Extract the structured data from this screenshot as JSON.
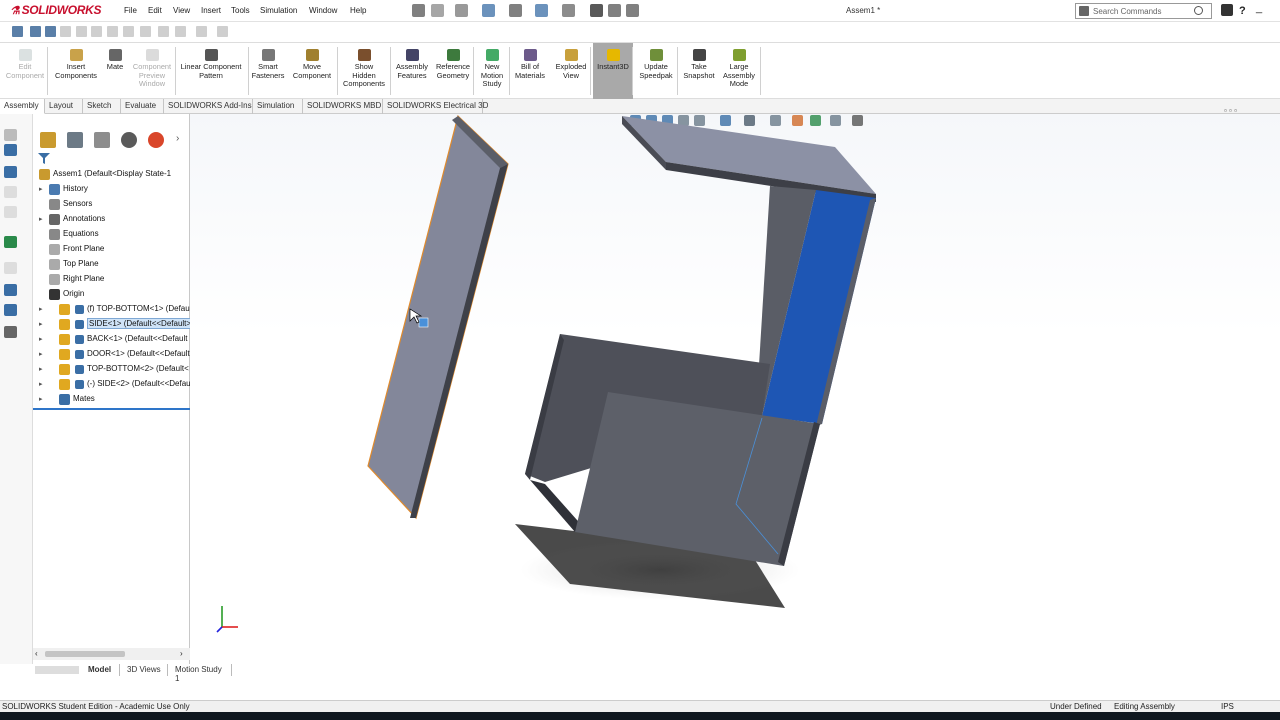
{
  "app": {
    "logo_text": "SOLIDWORKS",
    "doc_title": "Assem1 *"
  },
  "menu": [
    "File",
    "Edit",
    "View",
    "Insert",
    "Tools",
    "Simulation",
    "Window",
    "Help"
  ],
  "search": {
    "placeholder": "Search Commands"
  },
  "commands": [
    {
      "label": "Edit\nComponent",
      "disabled": true
    },
    {
      "label": "Insert\nComponents",
      "disabled": false
    },
    {
      "label": "Mate",
      "disabled": false
    },
    {
      "label": "Component\nPreview\nWindow",
      "disabled": true
    },
    {
      "label": "Linear Component\nPattern",
      "disabled": false
    },
    {
      "label": "Smart\nFasteners",
      "disabled": false
    },
    {
      "label": "Move\nComponent",
      "disabled": false
    },
    {
      "label": "Show\nHidden\nComponents",
      "disabled": false
    },
    {
      "label": "Assembly\nFeatures",
      "disabled": false
    },
    {
      "label": "Reference\nGeometry",
      "disabled": false
    },
    {
      "label": "New\nMotion\nStudy",
      "disabled": false
    },
    {
      "label": "Bill of\nMaterials",
      "disabled": false
    },
    {
      "label": "Exploded\nView",
      "disabled": false
    },
    {
      "label": "Instant3D",
      "disabled": false,
      "active": true
    },
    {
      "label": "Update\nSpeedpak",
      "disabled": false
    },
    {
      "label": "Take\nSnapshot",
      "disabled": false
    },
    {
      "label": "Large\nAssembly\nMode",
      "disabled": false
    }
  ],
  "tabs": [
    "Assembly",
    "Layout",
    "Sketch",
    "Evaluate",
    "SOLIDWORKS Add-Ins",
    "Simulation",
    "SOLIDWORKS MBD",
    "SOLIDWORKS Electrical 3D"
  ],
  "tree": [
    {
      "label": "Assem1  (Default<Display State-1",
      "icon": "assembly",
      "expand": "▾"
    },
    {
      "label": "History",
      "icon": "history",
      "expand": "▸"
    },
    {
      "label": "Sensors",
      "icon": "sensor",
      "expand": ""
    },
    {
      "label": "Annotations",
      "icon": "annotation",
      "expand": "▸"
    },
    {
      "label": "Equations",
      "icon": "equation",
      "expand": ""
    },
    {
      "label": "Front Plane",
      "icon": "plane",
      "expand": ""
    },
    {
      "label": "Top Plane",
      "icon": "plane",
      "expand": ""
    },
    {
      "label": "Right Plane",
      "icon": "plane",
      "expand": ""
    },
    {
      "label": "Origin",
      "icon": "origin",
      "expand": ""
    },
    {
      "label": "(f) TOP-BOTTOM<1> (Defau",
      "icon": "part",
      "expand": "▸"
    },
    {
      "label": "SIDE<1> (Default<<Default>",
      "icon": "part",
      "expand": "▸",
      "selected": true
    },
    {
      "label": "BACK<1> (Default<<Default",
      "icon": "part",
      "expand": "▸"
    },
    {
      "label": "DOOR<1> (Default<<Default",
      "icon": "part",
      "expand": "▸"
    },
    {
      "label": "TOP-BOTTOM<2> (Default<",
      "icon": "part",
      "expand": "▸"
    },
    {
      "label": "(-) SIDE<2> (Default<<Defau",
      "icon": "part",
      "expand": "▸"
    },
    {
      "label": "Mates",
      "icon": "mates",
      "expand": "▸"
    }
  ],
  "bottom_tabs": [
    "Model",
    "3D Views",
    "Motion Study 1"
  ],
  "status": {
    "left": "SOLIDWORKS Student Edition - Academic Use Only",
    "state": "Under Defined",
    "mode": "Editing Assembly",
    "units": "IPS"
  },
  "colors": {
    "brand": "#c8102e",
    "part_face": "#5d6069",
    "selected_face": "#1e56b4",
    "edge_highlight": "#e08a2c"
  }
}
